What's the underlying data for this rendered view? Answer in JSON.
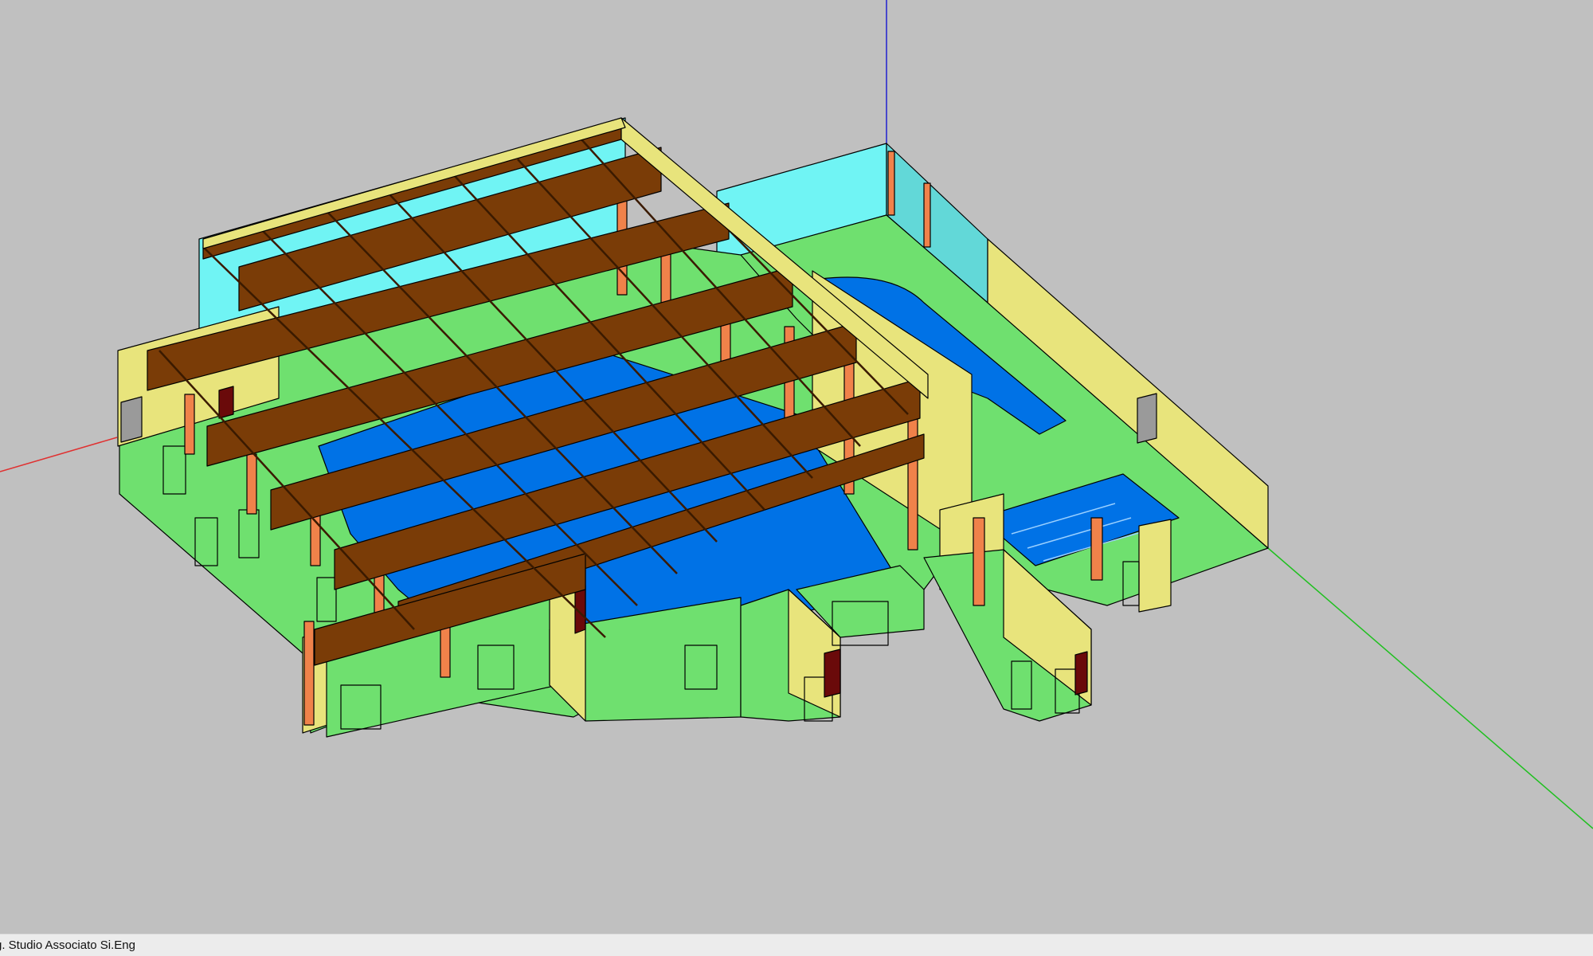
{
  "status_bar": {
    "text": "g. Studio Associato Si.Eng"
  },
  "colors": {
    "background": "#c0c0c0",
    "ground": "#6fe06f",
    "pool": "#0072e6",
    "glass": "#70f4f4",
    "wall": "#e8e47c",
    "beam": "#7a3c07",
    "column": "#f0824a",
    "door": "#6a0a0a",
    "axis_x": "#e03030",
    "axis_y": "#20c020",
    "axis_z": "#2020d0"
  }
}
